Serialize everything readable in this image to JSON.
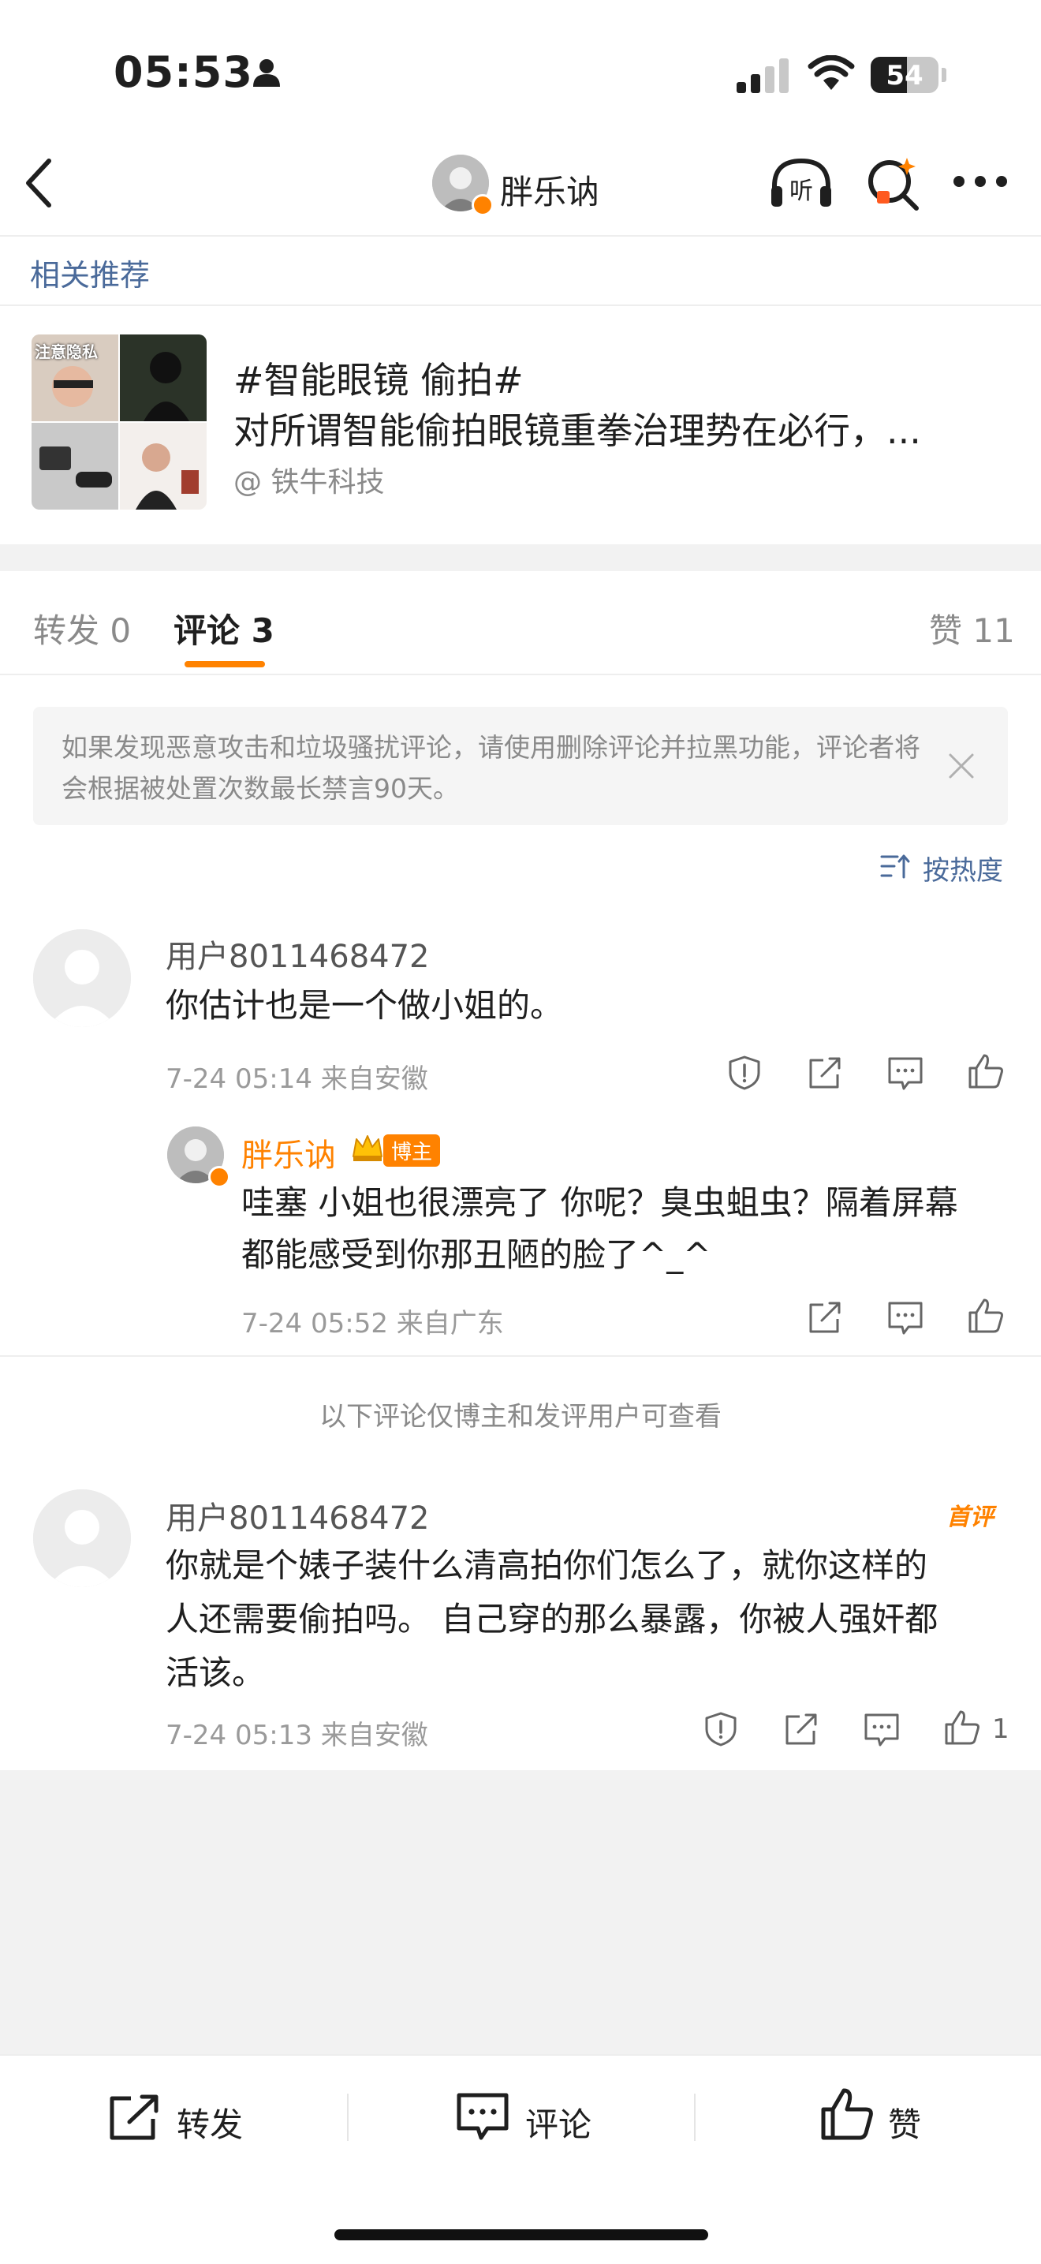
{
  "status_bar": {
    "time": "05:53",
    "battery": "54",
    "battery_level": 0.54
  },
  "nav": {
    "title": "胖乐讷"
  },
  "related": {
    "section_label": "相关推荐",
    "title_line1": "#智能眼镜 偷拍#",
    "title_line2": "对所谓智能偷拍眼镜重拳治理势在必行，...",
    "source": "@ 铁牛科技",
    "thumb_text": "注意隐私"
  },
  "tabs": {
    "repost": "转发 0",
    "comment": "评论 3",
    "like": "赞 11"
  },
  "notice": {
    "text": "如果发现恶意攻击和垃圾骚扰评论，请使用删除评论并拉黑功能，评论者将会根据被处置次数最长禁言90天。"
  },
  "sort": {
    "label": "按热度"
  },
  "comments": [
    {
      "user": "用户8011468472",
      "text": "你估计也是一个做小姐的。",
      "meta": "7-24 05:14  来自安徽",
      "reply": {
        "user": "胖乐讷",
        "badge": "博主",
        "text_line1": "哇塞 小姐也很漂亮了 你呢？臭虫蛆虫？隔着屏幕",
        "text_line2": "都能感受到你那丑陋的脸了^_^",
        "meta": "7-24 05:52  来自广东"
      }
    },
    {
      "user": "用户8011468472",
      "badge": "首评",
      "text_line1": "你就是个婊子装什么清高拍你们怎么了，就你这样的",
      "text_line2": "人还需要偷拍吗。 自己穿的那么暴露，你被人强奸都",
      "text_line3": "活该。",
      "meta": "7-24 05:13  来自安徽",
      "likes": "1"
    }
  ],
  "restricted_notice": "以下评论仅博主和发评用户可查看",
  "bottom_bar": {
    "repost": "转发",
    "comment": "评论",
    "like": "赞"
  }
}
